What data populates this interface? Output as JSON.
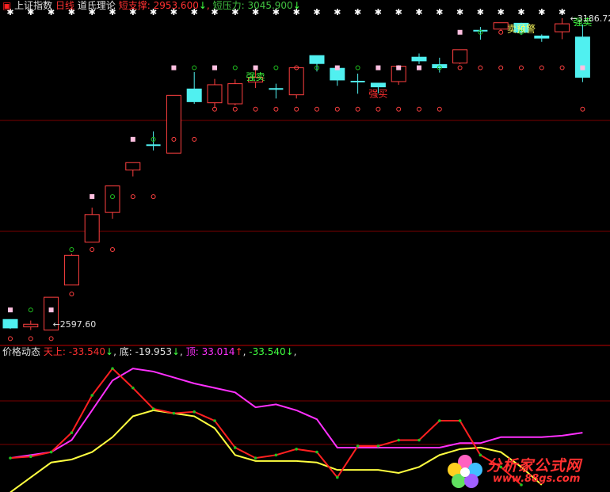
{
  "header": {
    "icon": "red-square-icon",
    "index_name": "上证指数",
    "period": "日线",
    "indicator": "道氏理论",
    "support_label": "短支撑:",
    "support_value": "2953.600",
    "support_arrow": "↓",
    "sep1": ",",
    "resist_label": "短压力:",
    "resist_value": "3045.900",
    "resist_arrow": "↓"
  },
  "sub_header": {
    "name": "价格动态",
    "tian_label": "天上:",
    "tian_value": "-33.540",
    "tian_arrow": "↓",
    "di_label": "底:",
    "di_value": "-19.953",
    "di_arrow": "↓",
    "ding_label": "顶:",
    "ding_value": "33.014",
    "ding_arrow": "↑",
    "last_value": "-33.540",
    "last_arrow": "↓"
  },
  "colors": {
    "up": "#ff4040",
    "down": "#50f0f0",
    "cross": "#50f0f0",
    "grid": "#7a0000",
    "yellow": "#ffff40",
    "magenta": "#ff30ff",
    "red_line": "#ff2020",
    "green_dot": "#20c020",
    "star": "#ffffff"
  },
  "chart_data": {
    "type": "candlestick",
    "max_label": "3186.72",
    "min_label": "2597.60",
    "candles": [
      {
        "o": 2618,
        "c": 2602,
        "h": 2618,
        "l": 2600
      },
      {
        "o": 2604,
        "c": 2609,
        "h": 2616,
        "l": 2598
      },
      {
        "o": 2598,
        "c": 2660,
        "h": 2660,
        "l": 2597.6
      },
      {
        "o": 2683,
        "c": 2739,
        "h": 2742,
        "l": 2683
      },
      {
        "o": 2764,
        "c": 2816,
        "h": 2829,
        "l": 2764
      },
      {
        "o": 2820,
        "c": 2870,
        "h": 2870,
        "l": 2808
      },
      {
        "o": 2900,
        "c": 2914,
        "h": 2914,
        "l": 2888
      },
      {
        "o": 2947,
        "c": 2947,
        "h": 2973,
        "l": 2937
      },
      {
        "o": 2932,
        "c": 3041,
        "h": 3041,
        "l": 2932
      },
      {
        "o": 3053,
        "c": 3029,
        "h": 3085,
        "l": 3025
      },
      {
        "o": 3027,
        "c": 3061,
        "h": 3072,
        "l": 3017
      },
      {
        "o": 3025,
        "c": 3063,
        "h": 3071,
        "l": 3022
      },
      {
        "o": 3066,
        "c": 3075,
        "h": 3089,
        "l": 3055
      },
      {
        "o": 3053,
        "c": 3053,
        "h": 3063,
        "l": 3035
      },
      {
        "o": 3042,
        "c": 3093,
        "h": 3093,
        "l": 3035
      },
      {
        "o": 3116,
        "c": 3101,
        "h": 3116,
        "l": 3086
      },
      {
        "o": 3092,
        "c": 3070,
        "h": 3097,
        "l": 3059
      },
      {
        "o": 3067,
        "c": 3067,
        "h": 3082,
        "l": 3044
      },
      {
        "o": 3064,
        "c": 3057,
        "h": 3064,
        "l": 3045
      },
      {
        "o": 3067,
        "c": 3096,
        "h": 3098,
        "l": 3061
      },
      {
        "o": 3113,
        "c": 3106,
        "h": 3120,
        "l": 3100
      },
      {
        "o": 3099,
        "c": 3093,
        "h": 3112,
        "l": 3084
      },
      {
        "o": 3102,
        "c": 3127,
        "h": 3127,
        "l": 3100
      },
      {
        "o": 3163,
        "c": 3163,
        "h": 3170,
        "l": 3146
      },
      {
        "o": 3166,
        "c": 3178,
        "h": 3178,
        "l": 3164
      },
      {
        "o": 3177,
        "c": 3160,
        "h": 3178,
        "l": 3155
      },
      {
        "o": 3153,
        "c": 3149,
        "h": 3156,
        "l": 3142
      },
      {
        "o": 3161,
        "c": 3176,
        "h": 3186.72,
        "l": 3147
      },
      {
        "o": 3151,
        "c": 3075,
        "h": 3175,
        "l": 3066
      }
    ],
    "markers": [
      {
        "i": 0,
        "type": "pink",
        "v": 2636
      },
      {
        "i": 0,
        "type": "redcirc",
        "v": 2582
      },
      {
        "i": 1,
        "type": "green",
        "v": 2636
      },
      {
        "i": 1,
        "type": "redcirc",
        "v": 2582
      },
      {
        "i": 2,
        "type": "pink",
        "v": 2636
      },
      {
        "i": 2,
        "type": "redcirc",
        "v": 2582
      },
      {
        "i": 3,
        "type": "green",
        "v": 2750
      },
      {
        "i": 3,
        "type": "redcirc",
        "v": 2666
      },
      {
        "i": 4,
        "type": "pink",
        "v": 2850
      },
      {
        "i": 4,
        "type": "redcirc",
        "v": 2750
      },
      {
        "i": 5,
        "type": "green",
        "v": 2850
      },
      {
        "i": 5,
        "type": "redcirc",
        "v": 2750
      },
      {
        "i": 6,
        "type": "pink",
        "v": 2958
      },
      {
        "i": 6,
        "type": "redcirc",
        "v": 2850
      },
      {
        "i": 7,
        "type": "green",
        "v": 2958
      },
      {
        "i": 7,
        "type": "redcirc",
        "v": 2850
      },
      {
        "i": 8,
        "type": "pink",
        "v": 3093
      },
      {
        "i": 8,
        "type": "redcirc",
        "v": 2958
      },
      {
        "i": 9,
        "type": "green",
        "v": 3093
      },
      {
        "i": 9,
        "type": "redcirc",
        "v": 2958
      },
      {
        "i": 10,
        "type": "pink",
        "v": 3093
      },
      {
        "i": 10,
        "type": "redcirc",
        "v": 3015
      },
      {
        "i": 11,
        "type": "green",
        "v": 3093
      },
      {
        "i": 11,
        "type": "redcirc",
        "v": 3015
      },
      {
        "i": 12,
        "type": "pink",
        "v": 3093
      },
      {
        "i": 12,
        "type": "redcirc",
        "v": 3015
      },
      {
        "i": 13,
        "type": "green",
        "v": 3093
      },
      {
        "i": 13,
        "type": "redcirc",
        "v": 3015
      },
      {
        "i": 14,
        "type": "redcirc",
        "v": 3093
      },
      {
        "i": 14,
        "type": "redcirc",
        "v": 3015
      },
      {
        "i": 15,
        "type": "green",
        "v": 3093
      },
      {
        "i": 15,
        "type": "redcirc",
        "v": 3015
      },
      {
        "i": 16,
        "type": "pink",
        "v": 3093
      },
      {
        "i": 16,
        "type": "redcirc",
        "v": 3015
      },
      {
        "i": 17,
        "type": "green",
        "v": 3093
      },
      {
        "i": 17,
        "type": "redcirc",
        "v": 3015
      },
      {
        "i": 18,
        "type": "pink",
        "v": 3093
      },
      {
        "i": 18,
        "type": "redcirc",
        "v": 3015
      },
      {
        "i": 19,
        "type": "pink",
        "v": 3093
      },
      {
        "i": 19,
        "type": "redcirc",
        "v": 3015
      },
      {
        "i": 20,
        "type": "green",
        "v": 3093
      },
      {
        "i": 20,
        "type": "redcirc",
        "v": 3015
      },
      {
        "i": 20,
        "type": "pink",
        "v": 3093
      },
      {
        "i": 21,
        "type": "green",
        "v": 3093
      },
      {
        "i": 21,
        "type": "redcirc",
        "v": 3015
      },
      {
        "i": 22,
        "type": "pink",
        "v": 3160
      },
      {
        "i": 22,
        "type": "redcirc",
        "v": 3093
      },
      {
        "i": 23,
        "type": "green",
        "v": 3160
      },
      {
        "i": 23,
        "type": "redcirc",
        "v": 3093
      },
      {
        "i": 24,
        "type": "redcirc",
        "v": 3160
      },
      {
        "i": 24,
        "type": "redcirc",
        "v": 3093
      },
      {
        "i": 25,
        "type": "green",
        "v": 3160
      },
      {
        "i": 25,
        "type": "redcirc",
        "v": 3093
      },
      {
        "i": 26,
        "type": "redcirc",
        "v": 3093
      },
      {
        "i": 27,
        "type": "redcirc",
        "v": 3093
      },
      {
        "i": 28,
        "type": "pink",
        "v": 3093
      },
      {
        "i": 28,
        "type": "redcirc",
        "v": 3015
      }
    ],
    "stars_at": [
      0,
      1,
      2,
      3,
      4,
      5,
      6,
      7,
      8,
      9,
      10,
      11,
      12,
      13,
      14,
      15,
      16,
      17,
      18,
      19,
      20,
      21,
      22,
      23,
      24,
      25,
      26,
      27
    ],
    "annotations": [
      {
        "i": 12,
        "text": "强卖",
        "color": "#40ff40",
        "v": 3070
      },
      {
        "i": 18,
        "text": "强买",
        "color": "#ff3030",
        "v": 3038
      },
      {
        "i": 25,
        "text": "卖预警",
        "color": "#ffff60",
        "v": 3160
      },
      {
        "i": 28,
        "text": "强卖",
        "color": "#40ff40",
        "v": 3173
      }
    ],
    "ylim": [
      2575,
      3197
    ],
    "osc": {
      "ylim": [
        -40,
        45
      ],
      "magenta": [
        -22,
        -20,
        -18,
        -10,
        10,
        30,
        38,
        36,
        32,
        28,
        25,
        22,
        12,
        14,
        10,
        4,
        -15,
        -15,
        -15,
        -15,
        -15,
        -15,
        -12,
        -12,
        -8,
        -8,
        -8,
        -7,
        -5
      ],
      "red": [
        -22,
        -21,
        -18,
        -5,
        20,
        38,
        25,
        11,
        8,
        9,
        3,
        -15,
        -22,
        -20,
        -16,
        -18,
        -35,
        -14,
        -14,
        -10,
        -10,
        3,
        3,
        -20,
        -28,
        -40
      ],
      "yellow": [
        -45,
        -35,
        -25,
        -23,
        -18,
        -8,
        6,
        10,
        8,
        6,
        -2,
        -20,
        -24,
        -24,
        -24,
        -25,
        -30,
        -30,
        -30,
        -32,
        -28,
        -20,
        -16,
        -15,
        -18,
        -28,
        -40
      ]
    }
  },
  "logo": {
    "name": "分析家公式网",
    "url": "www.88gs.com"
  }
}
